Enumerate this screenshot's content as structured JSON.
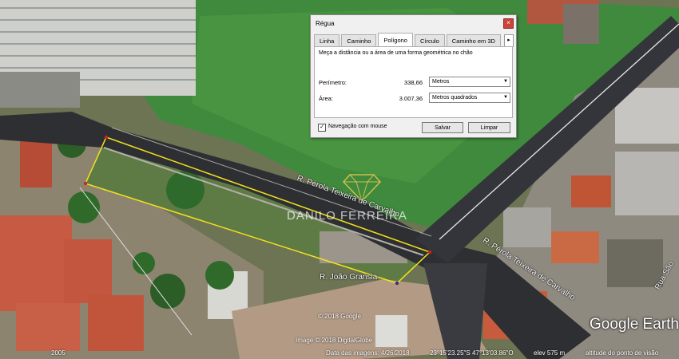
{
  "dialog": {
    "title": "Régua",
    "close_label": "×",
    "tabs": [
      "Linha",
      "Caminho",
      "Polígono",
      "Círculo",
      "Caminho em 3D"
    ],
    "active_tab": "Polígono",
    "tab_scroll": "▸",
    "description": "Meça a distância ou a área de uma forma geométrica no chão",
    "perimeter": {
      "label": "Perímetro:",
      "value": "338,66",
      "unit": "Metros"
    },
    "area": {
      "label": "Área:",
      "value": "3.007,36",
      "unit": "Metros quadrados"
    },
    "mouse_nav_label": "Navegação com mouse",
    "mouse_nav_checked": "✓",
    "save_label": "Salvar",
    "clear_label": "Limpar"
  },
  "map": {
    "streets": [
      "R. Pérola Teixeira de Carvalho",
      "R. Pérola Teixeira de Carvalho",
      "R. João Gransia",
      "Rua São"
    ],
    "watermark": "DANILO FERREIRA",
    "image_credit": "© 2018 Google",
    "image_credit2": "Image © 2018 DigitalGlobe",
    "google_earth": "Google Earth",
    "year": "2005"
  },
  "status_bar": {
    "imagery_date": "Data das imagens: 4/26/2018",
    "coordinates": "23°15'23.25\"S   47°13'03.86\"O",
    "elevation": "elev   575 m",
    "eye_alt": "altitude do ponto de visão"
  },
  "colors": {
    "polygon": "#f2e21c",
    "road": "#2e2f33",
    "grass": "#3f8a3c"
  }
}
